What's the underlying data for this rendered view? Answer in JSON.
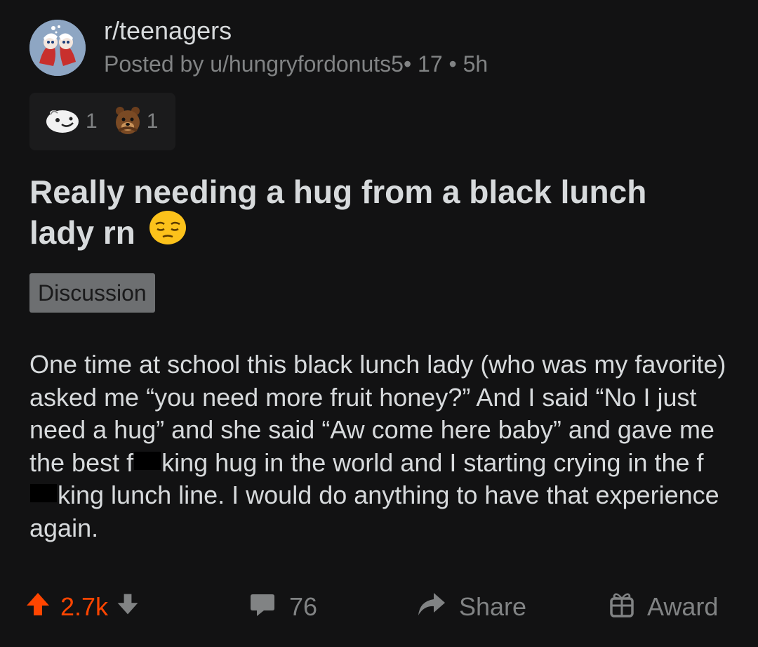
{
  "post": {
    "subreddit": "r/teenagers",
    "posted_by": "Posted by u/hungryfordonuts5",
    "user_flair_sep": "• 17",
    "time_sep": "• 5h",
    "awards": [
      {
        "icon": "wholesome-award-icon",
        "count": "1"
      },
      {
        "icon": "bear-award-icon",
        "count": "1"
      }
    ],
    "title": "Really needing a hug from a black lunch lady rn",
    "title_emoji": "pensive-face-emoji",
    "flair": "Discussion",
    "body": {
      "part1": "One time at school this black lunch lady (who was my favorite) asked me “you need more fruit honey?” And I said “No I just need a hug” and she said “Aw come here baby” and gave me the best f",
      "part2": "king hug in the world and I starting crying in the f",
      "part3": "king lunch line. I would do anything to have that experience again."
    }
  },
  "actions": {
    "score": "2.7k",
    "comments_count": "76",
    "share_label": "Share",
    "award_label": "Award"
  },
  "colors": {
    "background": "#121213",
    "upvote": "#ff4500",
    "text_primary": "#d7dadc",
    "text_secondary": "#818384",
    "flair_bg": "#6d6f71"
  }
}
